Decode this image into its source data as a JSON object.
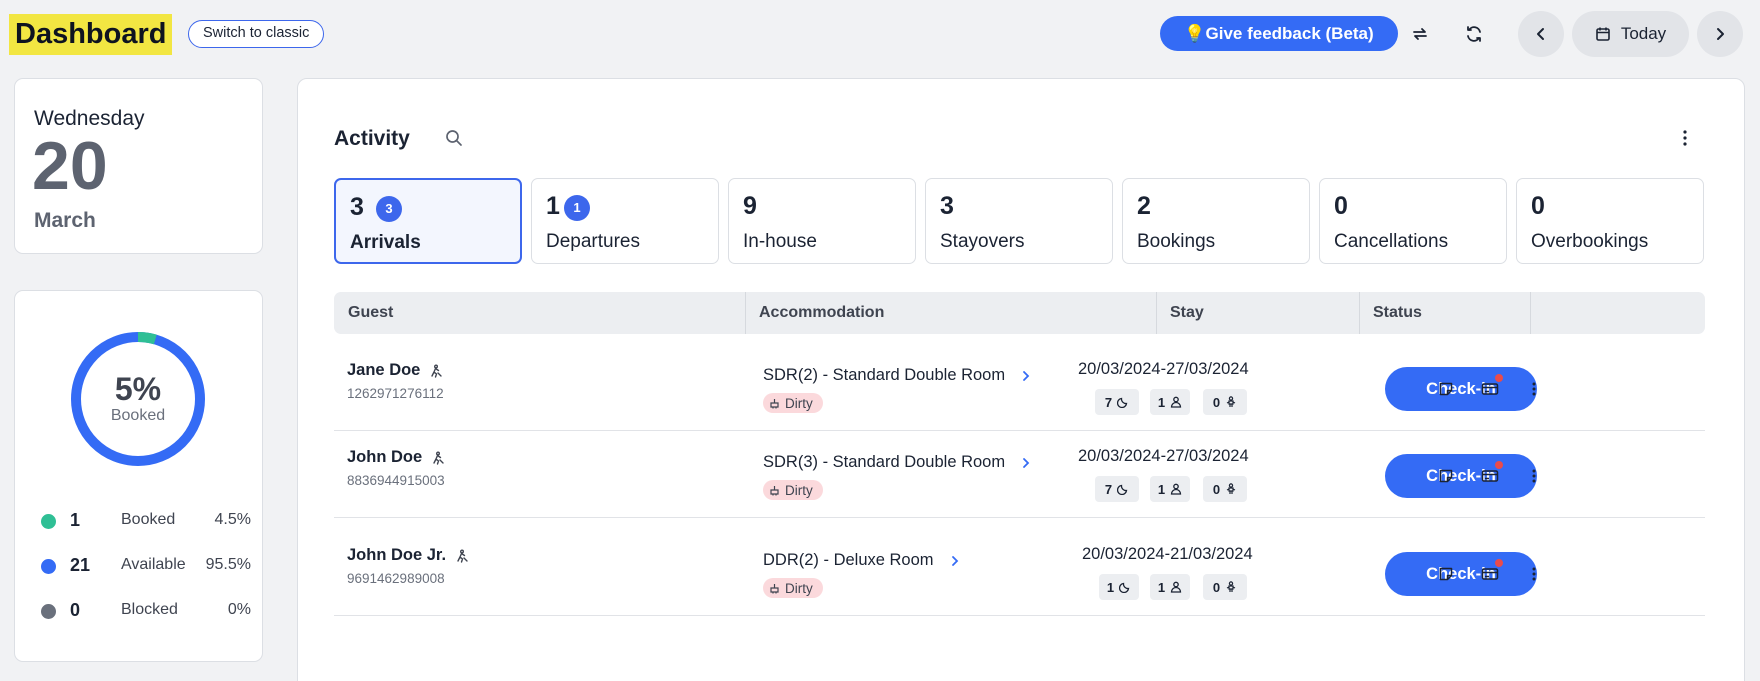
{
  "header": {
    "title": "Dashboard",
    "switch_label": "Switch to classic",
    "feedback_label": "💡Give feedback (Beta)",
    "today_label": "Today"
  },
  "date_card": {
    "weekday": "Wednesday",
    "day": "20",
    "month": "March"
  },
  "occupancy": {
    "percent_label": "5%",
    "caption": "Booked",
    "booked_fraction": 0.045,
    "legend": [
      {
        "count": "1",
        "label": "Booked",
        "pct": "4.5%",
        "color": "#2fbf95"
      },
      {
        "count": "21",
        "label": "Available",
        "pct": "95.5%",
        "color": "#346bf5"
      },
      {
        "count": "0",
        "label": "Blocked",
        "pct": "0%",
        "color": "#6a707c"
      }
    ]
  },
  "activity": {
    "title": "Activity",
    "stats": [
      {
        "num": "3",
        "badge": "3",
        "label": "Arrivals"
      },
      {
        "num": "1",
        "badge": "1",
        "label": "Departures"
      },
      {
        "num": "9",
        "label": "In-house"
      },
      {
        "num": "3",
        "label": "Stayovers"
      },
      {
        "num": "2",
        "label": "Bookings"
      },
      {
        "num": "0",
        "label": "Cancellations"
      },
      {
        "num": "0",
        "label": "Overbookings"
      }
    ],
    "columns": [
      "Guest",
      "Accommodation",
      "Stay",
      "Status"
    ],
    "rows": [
      {
        "name": "Jane Doe",
        "id": "1262971276112",
        "room": "SDR(2) - Standard Double Room",
        "status_tag": "Dirty",
        "dates": "20/03/2024-27/03/2024",
        "nights": "7",
        "adults": "1",
        "children": "0",
        "action": "Check-in"
      },
      {
        "name": "John Doe",
        "id": "8836944915003",
        "room": "SDR(3) - Standard Double Room",
        "status_tag": "Dirty",
        "dates": "20/03/2024-27/03/2024",
        "nights": "7",
        "adults": "1",
        "children": "0",
        "action": "Check-in"
      },
      {
        "name": "John Doe Jr.",
        "id": "9691462989008",
        "room": "DDR(2) - Deluxe Room",
        "status_tag": "Dirty",
        "dates": "20/03/2024-21/03/2024",
        "nights": "1",
        "adults": "1",
        "children": "0",
        "action": "Check-in"
      }
    ]
  }
}
